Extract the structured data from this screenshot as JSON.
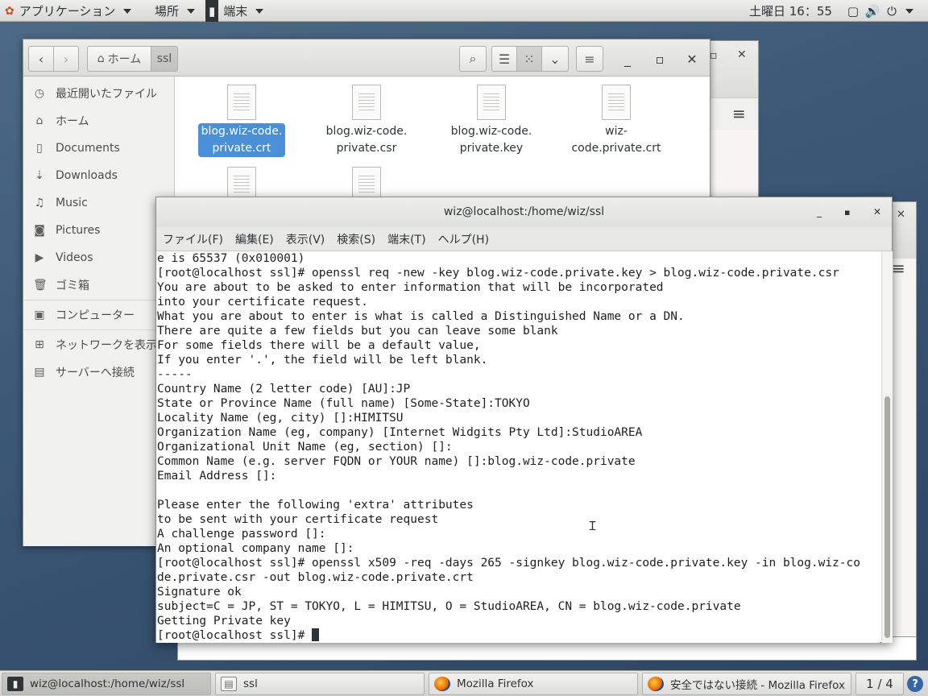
{
  "topbar": {
    "apps_label": "アプリケーション",
    "places_label": "場所",
    "terminal_label": "端末",
    "clock": "土曜日 16：55"
  },
  "files": {
    "breadcrumb": {
      "home": "ホーム",
      "current": "ssl"
    },
    "sidebar": [
      {
        "icon": "clock-icon",
        "glyph": "◷",
        "label": "最近開いたファイル"
      },
      {
        "icon": "home-icon",
        "glyph": "⌂",
        "label": "ホーム"
      },
      {
        "icon": "document-icon",
        "glyph": "▯",
        "label": "Documents"
      },
      {
        "icon": "download-icon",
        "glyph": "⇣",
        "label": "Downloads"
      },
      {
        "icon": "music-icon",
        "glyph": "♫",
        "label": "Music"
      },
      {
        "icon": "camera-icon",
        "glyph": "◙",
        "label": "Pictures"
      },
      {
        "icon": "video-icon",
        "glyph": "▶",
        "label": "Videos"
      },
      {
        "icon": "trash-icon",
        "glyph": "🗑",
        "label": "ゴミ箱"
      },
      {
        "icon": "computer-icon",
        "glyph": "▣",
        "label": "コンピューター"
      },
      {
        "icon": "network-icon",
        "glyph": "⊞",
        "label": "ネットワークを表示"
      },
      {
        "icon": "server-icon",
        "glyph": "▤",
        "label": "サーバーへ接続"
      }
    ],
    "files": [
      {
        "line1": "blog.wiz-code.",
        "line2": "private.crt",
        "selected": true
      },
      {
        "line1": "blog.wiz-code.",
        "line2": "private.csr",
        "selected": false
      },
      {
        "line1": "blog.wiz-code.",
        "line2": "private.key",
        "selected": false
      },
      {
        "line1": "wiz-code.private.crt",
        "line2": "",
        "selected": false
      }
    ]
  },
  "terminal": {
    "title": "wiz@localhost:/home/wiz/ssl",
    "menu": [
      "ファイル(F)",
      "編集(E)",
      "表示(V)",
      "検索(S)",
      "端末(T)",
      "ヘルプ(H)"
    ],
    "lines": [
      "e is 65537 (0x010001)",
      "[root@localhost ssl]# openssl req -new -key blog.wiz-code.private.key > blog.wiz-code.private.csr",
      "You are about to be asked to enter information that will be incorporated",
      "into your certificate request.",
      "What you are about to enter is what is called a Distinguished Name or a DN.",
      "There are quite a few fields but you can leave some blank",
      "For some fields there will be a default value,",
      "If you enter '.', the field will be left blank.",
      "-----",
      "Country Name (2 letter code) [AU]:JP",
      "State or Province Name (full name) [Some-State]:TOKYO",
      "Locality Name (eg, city) []:HIMITSU",
      "Organization Name (eg, company) [Internet Widgits Pty Ltd]:StudioAREA",
      "Organizational Unit Name (eg, section) []:",
      "Common Name (e.g. server FQDN or YOUR name) []:blog.wiz-code.private",
      "Email Address []:",
      "",
      "Please enter the following 'extra' attributes",
      "to be sent with your certificate request",
      "A challenge password []:",
      "An optional company name []:",
      "[root@localhost ssl]# openssl x509 -req -days 265 -signkey blog.wiz-code.private.key -in blog.wiz-co",
      "de.private.csr -out blog.wiz-code.private.crt",
      "Signature ok",
      "subject=C = JP, ST = TOKYO, L = HIMITSU, O = StudioAREA, CN = blog.wiz-code.private",
      "Getting Private key"
    ],
    "prompt": "[root@localhost ssl]# "
  },
  "taskbar": {
    "items": [
      {
        "label": "wiz@localhost:/home/wiz/ssl",
        "icon": "terminal-icon",
        "active": true
      },
      {
        "label": "ssl",
        "icon": "files-icon",
        "active": false
      },
      {
        "label": "Mozilla Firefox",
        "icon": "firefox-icon",
        "active": false
      },
      {
        "label": "安全ではない接続 - Mozilla Firefox",
        "icon": "firefox-icon",
        "active": false
      }
    ],
    "workspace": "1 / 4",
    "help": "?"
  }
}
